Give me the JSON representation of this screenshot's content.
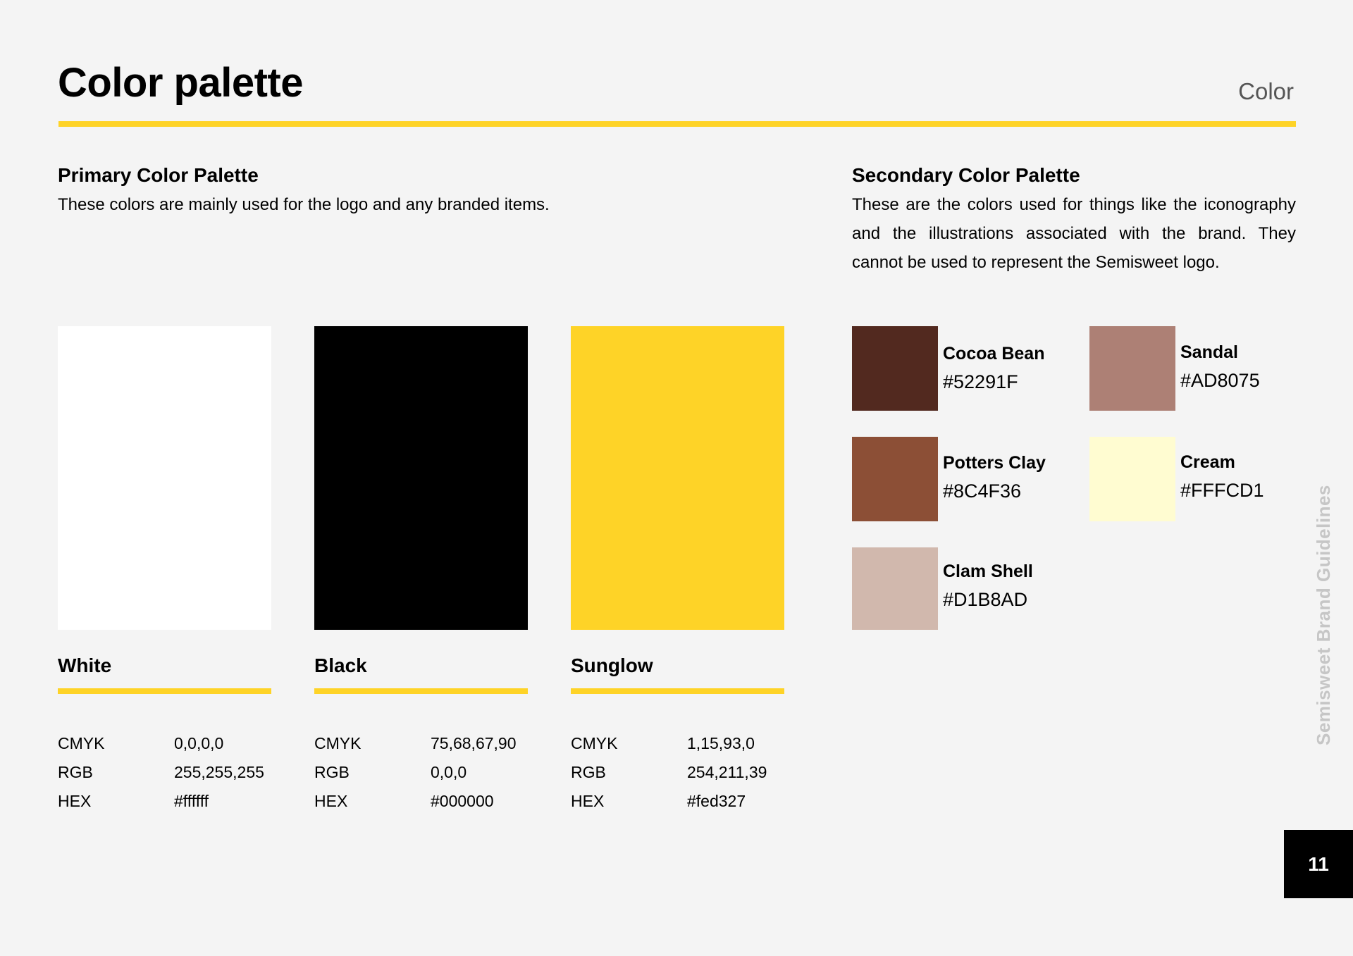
{
  "header": {
    "title": "Color palette",
    "section": "Color"
  },
  "primary": {
    "heading": "Primary Color Palette",
    "description": "These colors are mainly used for the logo and any branded items.",
    "colors": [
      {
        "name": "White",
        "swatch": "#ffffff",
        "specs": [
          {
            "k": "CMYK",
            "v": "0,0,0,0"
          },
          {
            "k": "RGB",
            "v": "255,255,255"
          },
          {
            "k": "HEX",
            "v": "#ffffff"
          }
        ]
      },
      {
        "name": "Black",
        "swatch": "#000000",
        "specs": [
          {
            "k": "CMYK",
            "v": "75,68,67,90"
          },
          {
            "k": "RGB",
            "v": "0,0,0"
          },
          {
            "k": "HEX",
            "v": "#000000"
          }
        ]
      },
      {
        "name": "Sunglow",
        "swatch": "#fed327",
        "specs": [
          {
            "k": "CMYK",
            "v": "1,15,93,0"
          },
          {
            "k": "RGB",
            "v": "254,211,39"
          },
          {
            "k": "HEX",
            "v": "#fed327"
          }
        ]
      }
    ]
  },
  "secondary": {
    "heading": "Secondary Color Palette",
    "description": "These are the colors used for things like the iconography and the illustrations associated with the brand. They cannot be used to represent the Semisweet logo.",
    "colors": [
      {
        "name": "Cocoa Bean",
        "hex": "#52291F"
      },
      {
        "name": "Sandal",
        "hex": "#AD8075"
      },
      {
        "name": "Potters Clay",
        "hex": "#8C4F36"
      },
      {
        "name": "Cream",
        "hex": "#FFFCD1"
      },
      {
        "name": "Clam Shell",
        "hex": "#D1B8AD"
      }
    ]
  },
  "side_label": "Semisweet Brand Guidelines",
  "page_number": "11",
  "accent_color": "#fed327"
}
